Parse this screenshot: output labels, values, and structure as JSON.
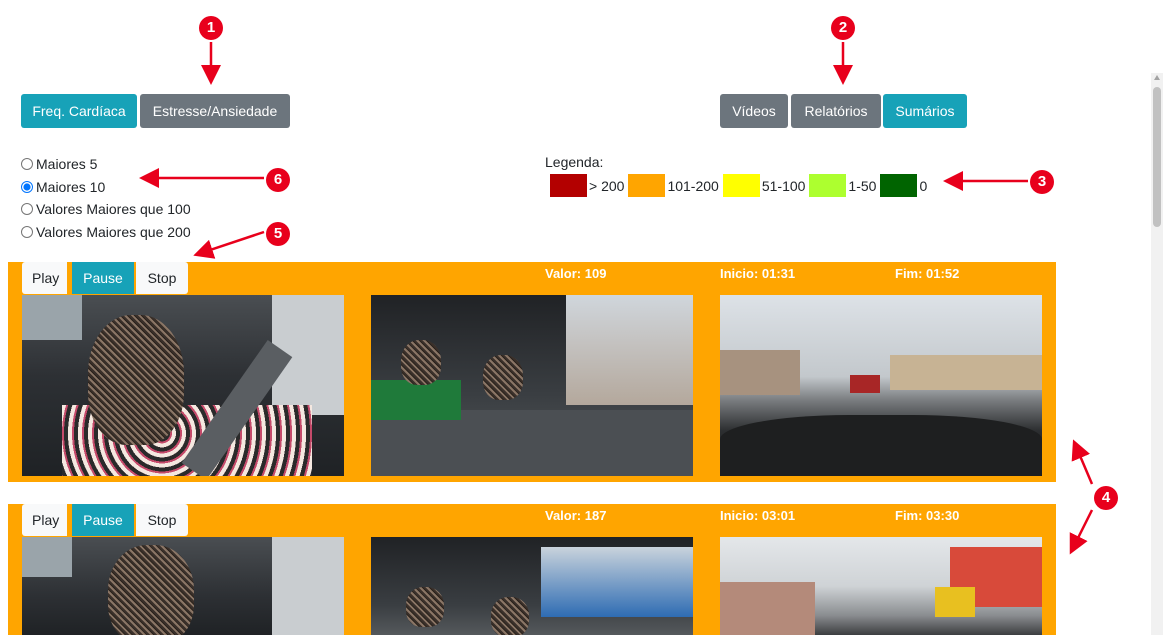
{
  "left_toolbar": {
    "heart_rate_label": "Freq. Cardíaca",
    "stress_label": "Estresse/Ansiedade"
  },
  "right_toolbar": {
    "videos_label": "Vídeos",
    "reports_label": "Relatórios",
    "summaries_label": "Sumários"
  },
  "filters": {
    "options": [
      "Maiores 5",
      "Maiores 10",
      "Valores Maiores que 100",
      "Valores Maiores que 200"
    ],
    "selected": "Maiores 10"
  },
  "legend": {
    "title": "Legenda:",
    "items": [
      {
        "color": "#b30000",
        "label": "> 200"
      },
      {
        "color": "#ffa500",
        "label": "101-200"
      },
      {
        "color": "#ffff00",
        "label": "51-100"
      },
      {
        "color": "#adff2f",
        "label": "1-50"
      },
      {
        "color": "#006400",
        "label": "0"
      }
    ]
  },
  "markers": [
    "1",
    "2",
    "3",
    "4",
    "5",
    "6"
  ],
  "segments": [
    {
      "play_label": "Play",
      "pause_label": "Pause",
      "stop_label": "Stop",
      "value": "Valor: 109",
      "start": "Inicio: 01:31",
      "end": "Fim: 01:52"
    },
    {
      "play_label": "Play",
      "pause_label": "Pause",
      "stop_label": "Stop",
      "value": "Valor: 187",
      "start": "Inicio: 03:01",
      "end": "Fim: 03:30"
    }
  ],
  "colors": {
    "accent": "#17a2b8",
    "secondary": "#6c757d",
    "segment_bg": "#ffa500",
    "marker": "#e8001c"
  }
}
